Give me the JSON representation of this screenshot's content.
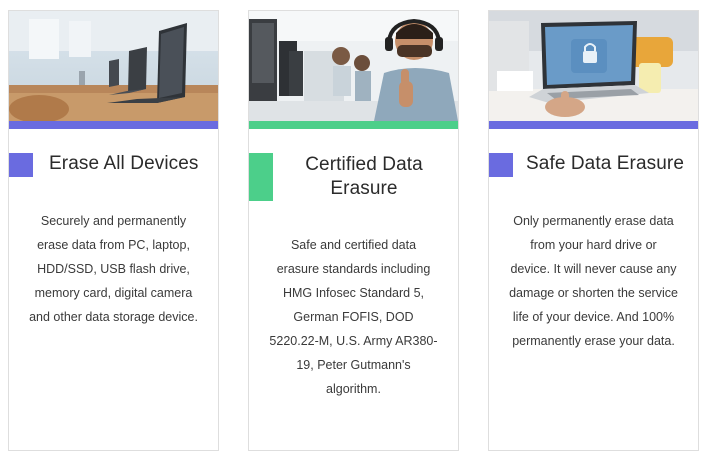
{
  "colors": {
    "purple_accent": "#6a6be0",
    "green_accent": "#4ccf8a",
    "card_border": "#dedede",
    "title_text": "#2b2b2b",
    "body_text": "#3a3a3a"
  },
  "cards": [
    {
      "image": "office-laptops-photo",
      "accent": "#6a6be0",
      "title": "Erase All Devices",
      "description": "Securely and permanently erase data from PC, laptop, HDD/SSD, USB flash drive, memory card, digital camera and other data storage device."
    },
    {
      "image": "support-agent-thumbs-up-photo",
      "accent": "#4ccf8a",
      "title": "Certified Data Erasure",
      "description": "Safe and certified data erasure standards including HMG Infosec Standard 5, German FOFIS, DOD 5220.22-M, U.S. Army AR380-19, Peter Gutmann's algorithm."
    },
    {
      "image": "laptop-lock-screen-photo",
      "accent": "#6a6be0",
      "title": "Safe Data Erasure",
      "description": "Only permanently erase data from your hard drive or device. It will never cause any damage or shorten the service life of your device. And 100% permanently erase your data."
    }
  ]
}
